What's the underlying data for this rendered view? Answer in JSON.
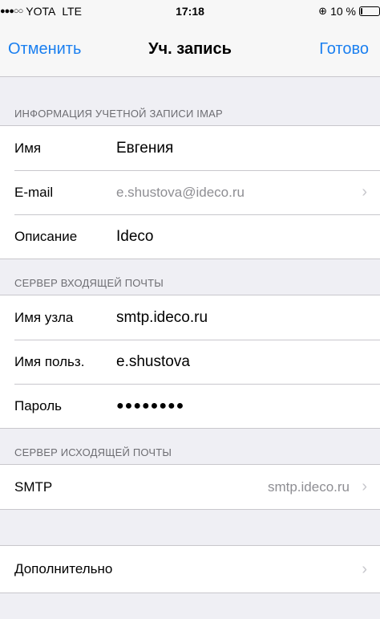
{
  "status_bar": {
    "signal": "●●●○○",
    "carrier": "YOTA",
    "network": "LTE",
    "time": "17:18",
    "lock_icon": "rotation-lock-icon",
    "battery": "10 %",
    "battery_level": 0.1
  },
  "nav": {
    "cancel": "Отменить",
    "title": "Уч. запись",
    "done": "Готово",
    "accent": "#1a7ff0"
  },
  "imap_section": {
    "header": "ИНФОРМАЦИЯ УЧЕТНОЙ ЗАПИСИ IMAP",
    "rows": [
      {
        "label": "Имя",
        "value": "Евгения"
      },
      {
        "label": "E-mail",
        "value": "e.shustova@ideco.ru"
      },
      {
        "label": "Описание",
        "value": "Ideco"
      }
    ]
  },
  "incoming_section": {
    "header": "СЕРВЕР ВХОДЯЩЕЙ ПОЧТЫ",
    "rows": [
      {
        "label": "Имя узла",
        "value": "smtp.ideco.ru"
      },
      {
        "label": "Имя польз.",
        "value": "e.shustova"
      },
      {
        "label": "Пароль",
        "value": "●●●●●●●●"
      }
    ]
  },
  "outgoing_section": {
    "header": "СЕРВЕР ИСХОДЯЩЕЙ ПОЧТЫ",
    "smtp_label": "SMTP",
    "smtp_value": "smtp.ideco.ru"
  },
  "advanced": {
    "label": "Дополнительно"
  },
  "chevron": "›"
}
